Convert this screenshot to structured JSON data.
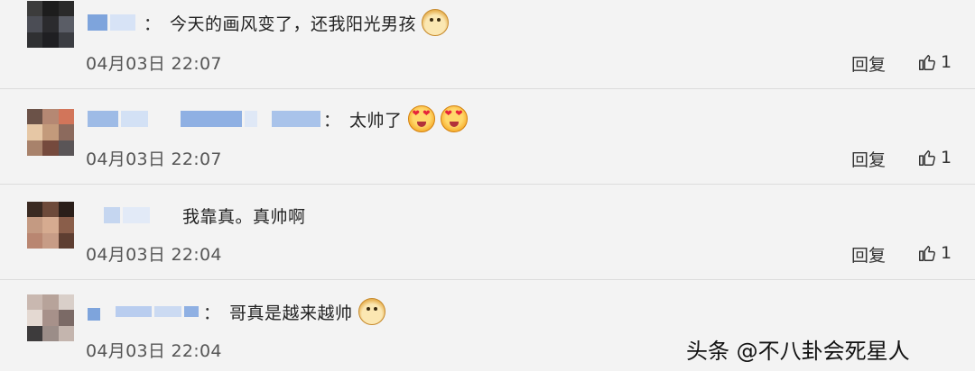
{
  "comments": [
    {
      "text": "今天的画风变了，还我阳光男孩",
      "emoji": [
        "doge"
      ],
      "date": "04月03日 22:07",
      "reply_label": "回复",
      "likes": "1",
      "colon": "："
    },
    {
      "text": "太帅了",
      "emoji": [
        "love-eyes",
        "love-eyes"
      ],
      "date": "04月03日 22:07",
      "reply_label": "回复",
      "likes": "1",
      "colon": "："
    },
    {
      "text": "我靠真。真帅啊",
      "emoji": [],
      "date": "04月03日 22:04",
      "reply_label": "回复",
      "likes": "1",
      "colon": ""
    },
    {
      "text": "哥真是越来越帅",
      "emoji": [
        "doge"
      ],
      "date": "04月03日 22:04",
      "colon": "："
    }
  ],
  "watermark": "头条 @不八卦会死星人",
  "colors": {
    "background": "#f3f3f3",
    "divider": "#dcdcdc",
    "blurred_name": "#8fb3e6"
  },
  "icons": {
    "like": "thumbs-up-icon"
  }
}
